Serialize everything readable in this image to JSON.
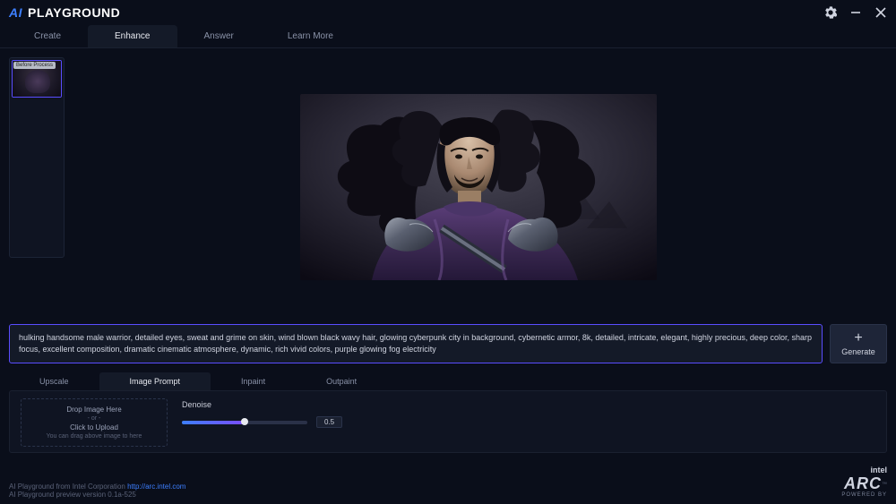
{
  "app": {
    "title_ai": "AI",
    "title_playground": "PLAYGROUND"
  },
  "main_tabs": {
    "create": "Create",
    "enhance": "Enhance",
    "answer": "Answer",
    "learn_more": "Learn More",
    "active": "enhance"
  },
  "thumb": {
    "label": "Before Process"
  },
  "prompt": {
    "text": "hulking handsome male warrior, detailed eyes, sweat and grime on skin, wind blown black wavy hair, glowing cyberpunk city in background, cybernetic armor, 8k, detailed, intricate, elegant, highly precious, deep color, sharp focus, excellent composition, dramatic cinematic atmosphere, dynamic, rich vivid colors, purple glowing fog electricity"
  },
  "generate": {
    "label": "Generate"
  },
  "sub_tabs": {
    "upscale": "Upscale",
    "image_prompt": "Image Prompt",
    "inpaint": "Inpaint",
    "outpaint": "Outpaint",
    "active": "image_prompt"
  },
  "dropzone": {
    "line1": "Drop Image Here",
    "line2": "- or -",
    "line3": "Click to Upload",
    "hint": "You can drag above image to here"
  },
  "denoise": {
    "label": "Denoise",
    "value": "0.5"
  },
  "footer": {
    "line1_pre": "AI Playground from Intel Corporation ",
    "line1_link": "http://arc.intel.com",
    "line2": "AI Playground preview version 0.1a-525"
  },
  "arc": {
    "intel": "intel",
    "arc": "ARC",
    "powered": "POWERED BY"
  }
}
